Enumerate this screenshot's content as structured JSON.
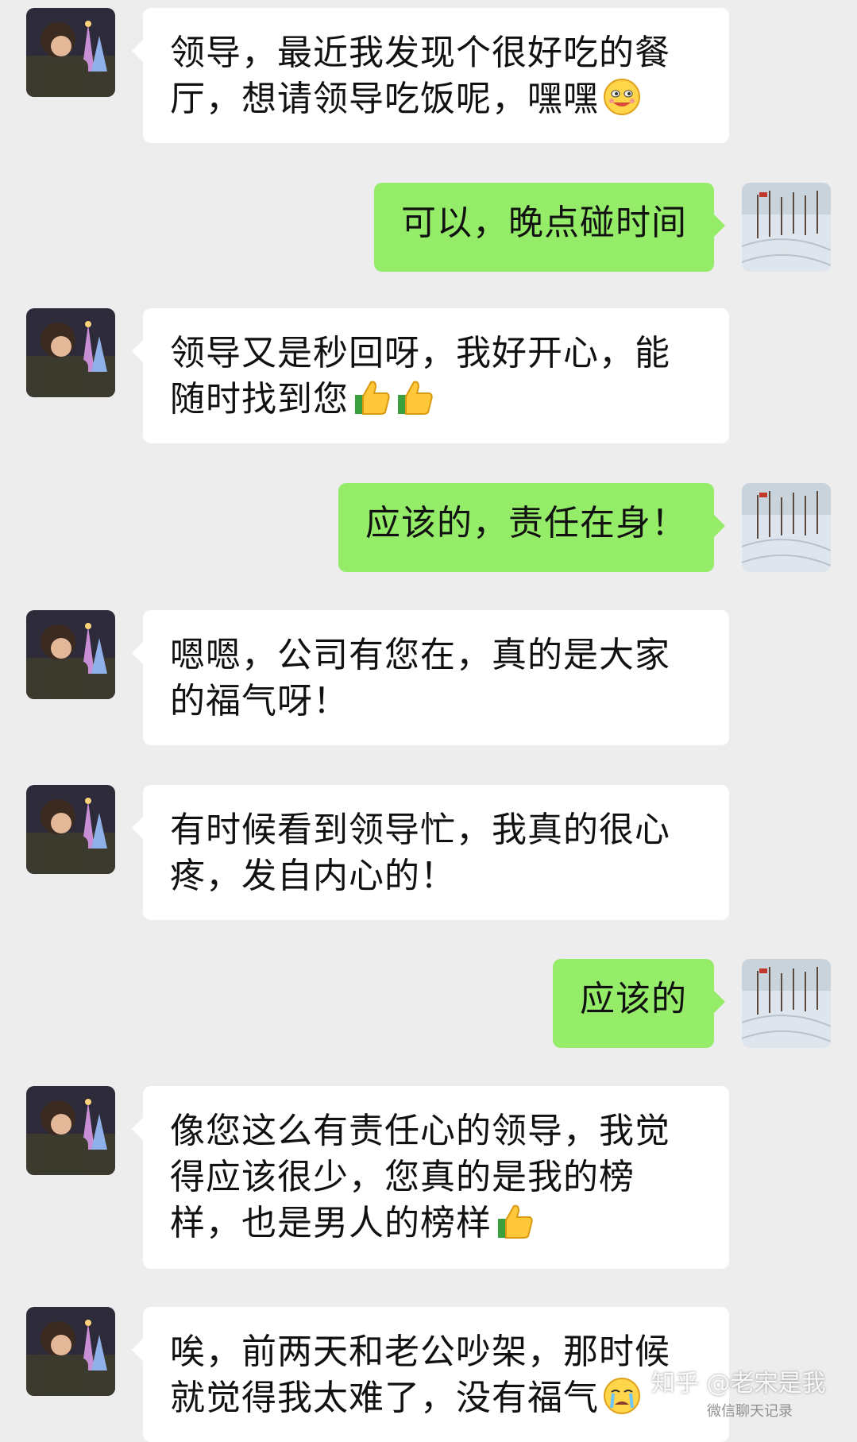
{
  "messages": [
    {
      "side": "left",
      "text": "领导，最近我发现个很好吃的餐厅，想请领导吃饭呢，嘿嘿",
      "emoji": "grin-emoji"
    },
    {
      "side": "right",
      "text": "可以，晚点碰时间"
    },
    {
      "side": "left",
      "text": "领导又是秒回呀，我好开心，能随时找到您",
      "emoji": "thumbs-up-emoji x2"
    },
    {
      "side": "right",
      "text": "应该的，责任在身！"
    },
    {
      "side": "left",
      "text": "嗯嗯，公司有您在，真的是大家的福气呀！"
    },
    {
      "side": "left",
      "text": "有时候看到领导忙，我真的很心疼，发自内心的！"
    },
    {
      "side": "right",
      "text": "应该的"
    },
    {
      "side": "left",
      "text": "像您这么有责任心的领导，我觉得应该很少，您真的是我的榜样，也是男人的榜样",
      "emoji": "thumbs-up-emoji"
    },
    {
      "side": "left",
      "text": "唉，前两天和老公吵架，那时候就觉得我太难了，没有福气",
      "emoji": "crying-emoji"
    }
  ],
  "watermark": "知乎 @老宋是我",
  "watermark_sub": "微信聊天记录"
}
